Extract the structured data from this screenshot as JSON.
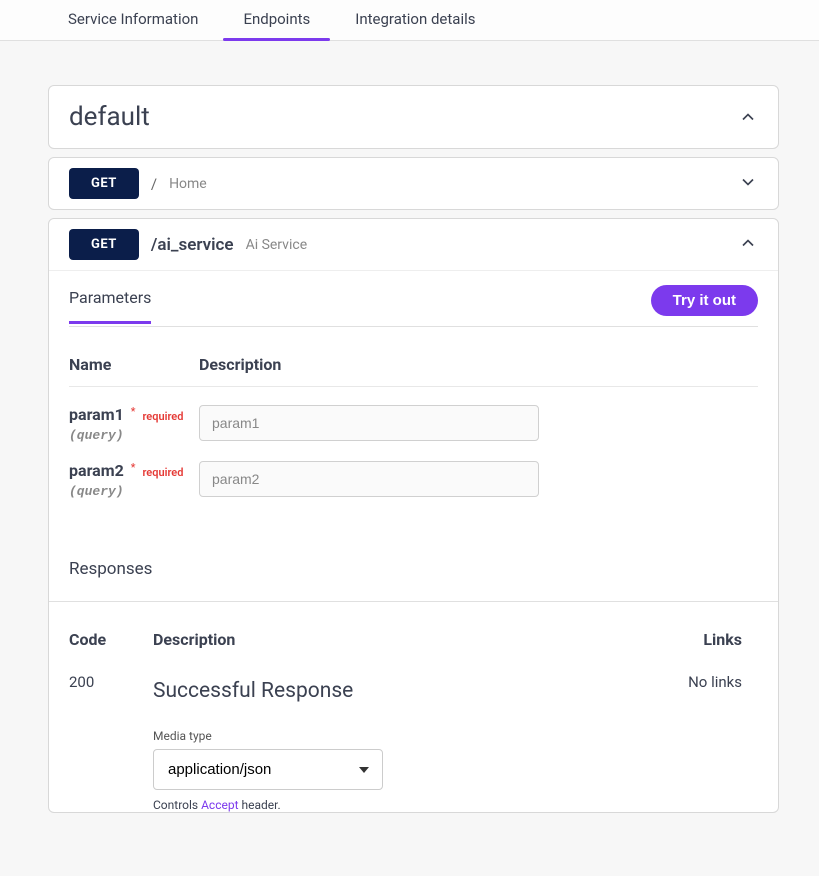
{
  "tabs": {
    "service_info": "Service Information",
    "endpoints": "Endpoints",
    "integration": "Integration details"
  },
  "section": {
    "title": "default"
  },
  "endpoints": {
    "home": {
      "method": "GET",
      "path": "/",
      "summary": "Home"
    },
    "ai_service": {
      "method": "GET",
      "path": "/ai_service",
      "summary": "Ai Service",
      "subtab": "Parameters",
      "try_label": "Try it out",
      "params_header_name": "Name",
      "params_header_desc": "Description",
      "params": [
        {
          "name": "param1",
          "required_star": "*",
          "required_label": "required",
          "type": "(query)",
          "placeholder": "param1"
        },
        {
          "name": "param2",
          "required_star": "*",
          "required_label": "required",
          "type": "(query)",
          "placeholder": "param2"
        }
      ],
      "responses_title": "Responses",
      "responses_header_code": "Code",
      "responses_header_desc": "Description",
      "responses_header_links": "Links",
      "responses": [
        {
          "code": "200",
          "title": "Successful Response",
          "media_label": "Media type",
          "media_value": "application/json",
          "controls_prefix": "Controls ",
          "controls_accent": "Accept",
          "controls_suffix": " header.",
          "links": "No links"
        }
      ]
    }
  }
}
